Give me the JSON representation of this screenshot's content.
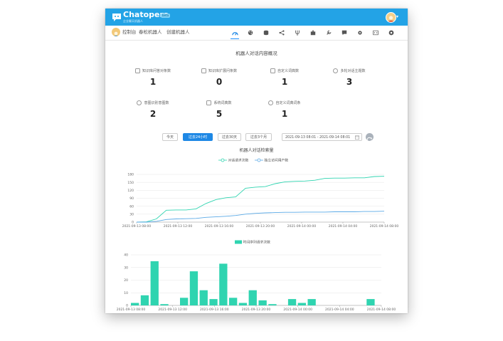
{
  "app": {
    "brand": "Chatopera",
    "brand_sub": "企业聊天机器人",
    "brand_badge": "beta",
    "nav": {
      "console": "控制台",
      "chatbots": "春松机器人",
      "create": "创建机器人"
    },
    "toolbar_icons": [
      "dashboard-icon",
      "palette-icon",
      "database-icon",
      "share-icon",
      "pitchfork-icon",
      "puzzle-icon",
      "wrench-icon",
      "chat-icon",
      "gear-icon",
      "code-icon",
      "github-icon"
    ]
  },
  "overview": {
    "title": "机器人对话内容概况",
    "stats": [
      {
        "label": "知识库问答对条数",
        "value": "1",
        "icon": "question-icon"
      },
      {
        "label": "知识库扩展问条数",
        "value": "0",
        "icon": "copy-icon"
      },
      {
        "label": "自定义词典数",
        "value": "1",
        "icon": "tools-icon"
      },
      {
        "label": "多轮对话主题数",
        "value": "3",
        "icon": "gears-icon"
      },
      {
        "label": "意图识别意图数",
        "value": "2",
        "icon": "target-icon"
      },
      {
        "label": "系统词典数",
        "value": "5",
        "icon": "book-icon"
      },
      {
        "label": "自定义词典词条",
        "value": "1",
        "icon": "user-circle-icon"
      }
    ]
  },
  "range": {
    "buttons": [
      "今天",
      "过去24小时",
      "过去30天",
      "过去3个月"
    ],
    "active_index": 1,
    "daterange": "2021-09-13 08:01 - 2021-09-14 08:01"
  },
  "search_chart": {
    "title": "机器人对话检索量",
    "chart_data": {
      "type": "line",
      "series": [
        {
          "name": "对话请求次数",
          "color": "#2fd4b0",
          "values": [
            0,
            1,
            12,
            45,
            46,
            46,
            50,
            70,
            85,
            92,
            95,
            128,
            132,
            134,
            145,
            152,
            154,
            155,
            158,
            165,
            166,
            166,
            167,
            167,
            172,
            173
          ]
        },
        {
          "name": "独立访问用户数",
          "color": "#5aa9e6",
          "values": [
            0,
            0,
            3,
            10,
            12,
            13,
            14,
            18,
            20,
            22,
            25,
            30,
            33,
            35,
            36,
            37,
            37,
            38,
            38,
            38,
            39,
            39,
            39,
            40,
            40,
            41
          ]
        }
      ],
      "ylim": [
        0,
        180
      ],
      "yticks": [
        "0",
        "30",
        "60",
        "90",
        "120",
        "150",
        "180"
      ],
      "xticks": [
        "2021-09-13 08:00",
        "2021-09-13 12:00",
        "2021-09-13 16:00",
        "2021-09-13 20:00",
        "2021-09-14 00:00",
        "2021-09-14 04:00",
        "2021-09-14 08:00"
      ]
    }
  },
  "hourly_chart": {
    "chart_data": {
      "type": "bar",
      "series": [
        {
          "name": "时间序列请求次数",
          "color": "#2fd4b0",
          "values": [
            2,
            8,
            35,
            1,
            0,
            6,
            27,
            12,
            5,
            33,
            6,
            2,
            12,
            4,
            1,
            0,
            5,
            2,
            5,
            0,
            0,
            0,
            0,
            0,
            5,
            0
          ]
        }
      ],
      "ylim": [
        0,
        40
      ],
      "yticks": [
        "0",
        "10",
        "20",
        "30",
        "40"
      ],
      "xticks": [
        "2021-09-13 08:00",
        "2021-09-13 12:00",
        "2021-09-13 16:00",
        "2021-09-13 20:00",
        "2021-09-14 00:00",
        "2021-09-14 04:00",
        "2021-09-14 08:00"
      ]
    }
  }
}
